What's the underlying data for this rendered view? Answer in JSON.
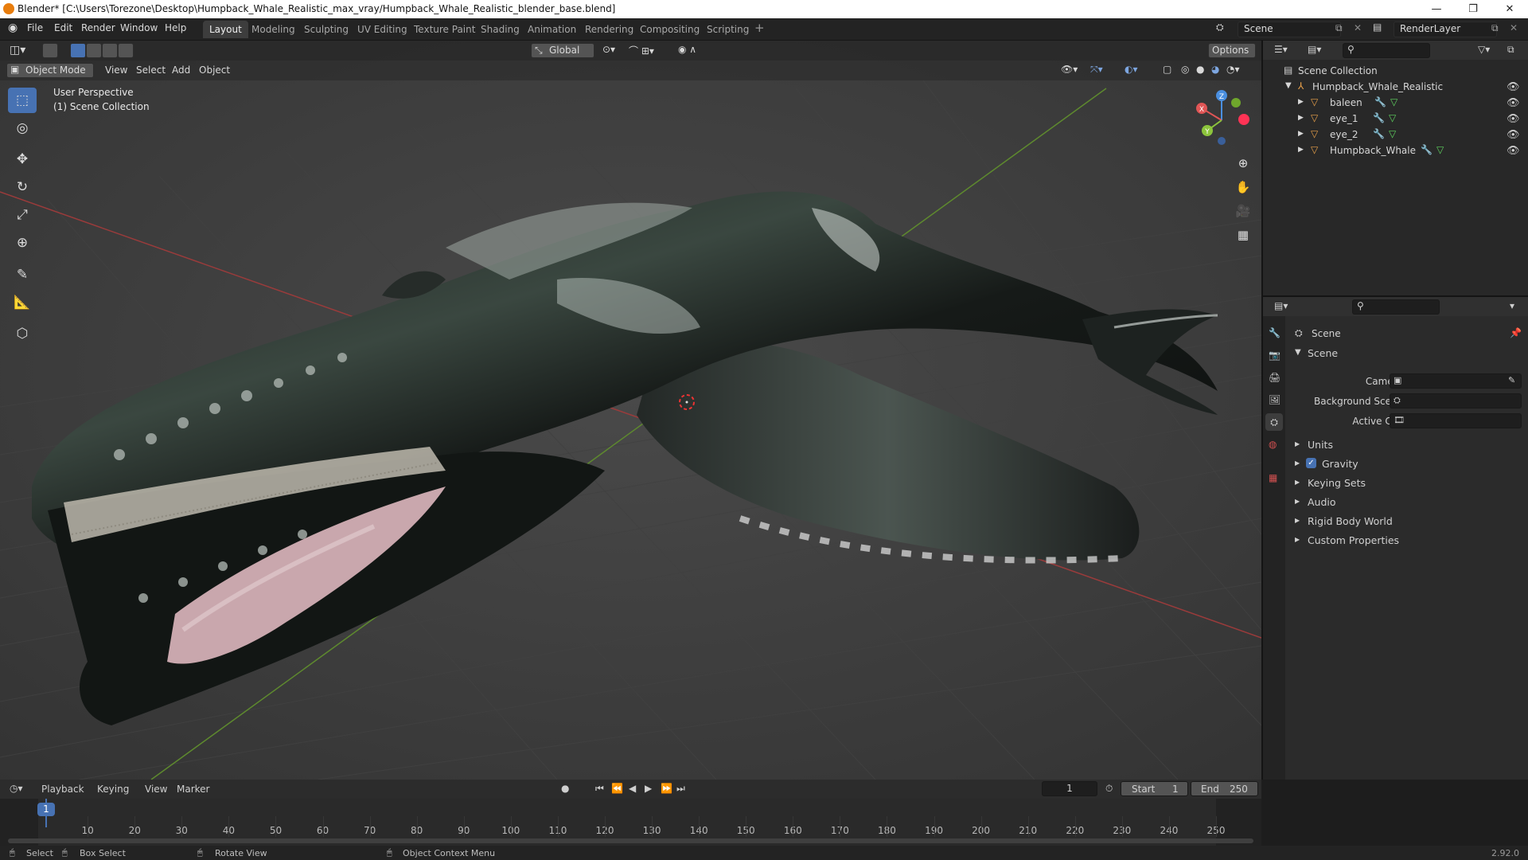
{
  "window": {
    "title": "Blender* [C:\\Users\\Torezone\\Desktop\\Humpback_Whale_Realistic_max_vray/Humpback_Whale_Realistic_blender_base.blend]"
  },
  "menu": {
    "items": [
      "File",
      "Edit",
      "Render",
      "Window",
      "Help"
    ],
    "workspaces": [
      "Layout",
      "Modeling",
      "Sculpting",
      "UV Editing",
      "Texture Paint",
      "Shading",
      "Animation",
      "Rendering",
      "Compositing",
      "Scripting"
    ],
    "active_workspace": "Layout",
    "scene_name": "Scene",
    "view_layer": "RenderLayer"
  },
  "viewport": {
    "mode": "Object Mode",
    "header_menus": [
      "View",
      "Select",
      "Add",
      "Object"
    ],
    "transform_orientation": "Global",
    "options_label": "Options",
    "overlay_text_1": "User Perspective",
    "overlay_text_2": "(1) Scene Collection",
    "gizmo": {
      "x": "X",
      "y": "Y",
      "z": "Z"
    },
    "colors": {
      "x_axis": "#e05555",
      "y_axis": "#8cc43c",
      "z_axis": "#4a8fe0",
      "active_tool": "#4772b3"
    }
  },
  "outliner": {
    "root": "Scene Collection",
    "collection": "Humpback_Whale_Realistic",
    "objects": [
      "baleen",
      "eye_1",
      "eye_2",
      "Humpback_Whale"
    ]
  },
  "properties": {
    "context": "Scene",
    "panel_title": "Scene",
    "fields": {
      "camera": "Camera",
      "background_scene": "Background Scene",
      "active_clip": "Active Clip"
    },
    "subpanels": [
      "Units",
      "Gravity",
      "Keying Sets",
      "Audio",
      "Rigid Body World",
      "Custom Properties"
    ],
    "gravity_enabled": true
  },
  "timeline": {
    "menus": [
      "Playback",
      "Keying",
      "View",
      "Marker"
    ],
    "current_frame": "1",
    "start_label": "Start",
    "start": "1",
    "end_label": "End",
    "end": "250",
    "ticks": [
      "10",
      "20",
      "30",
      "40",
      "50",
      "60",
      "70",
      "80",
      "90",
      "100",
      "110",
      "120",
      "130",
      "140",
      "150",
      "160",
      "170",
      "180",
      "190",
      "200",
      "210",
      "220",
      "230",
      "240",
      "250"
    ]
  },
  "statusbar": {
    "select": "Select",
    "box_select": "Box Select",
    "rotate_view": "Rotate View",
    "context_menu": "Object Context Menu",
    "version": "2.92.0"
  }
}
